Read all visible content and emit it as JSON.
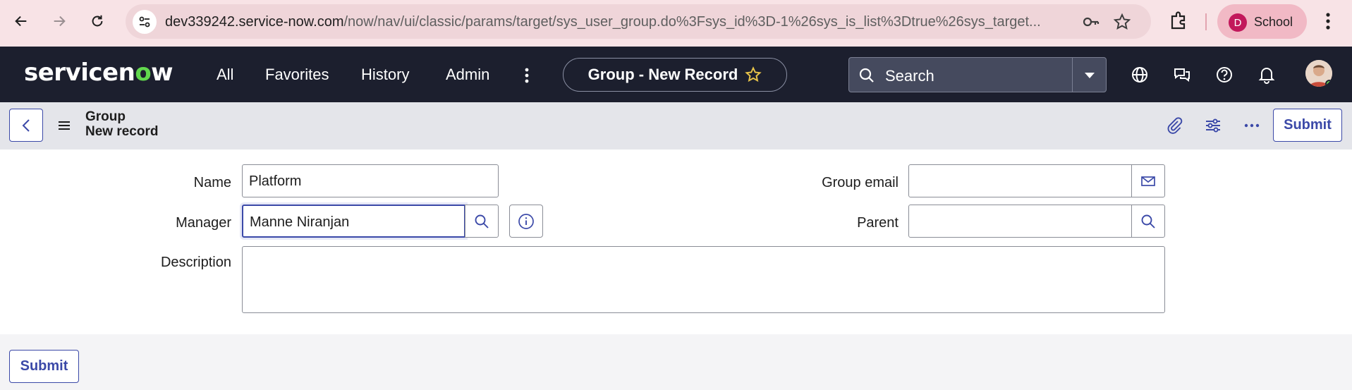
{
  "browser": {
    "url_host": "dev339242.service-now.com",
    "url_path": "/now/nav/ui/classic/params/target/sys_user_group.do%3Fsys_id%3D-1%26sys_is_list%3Dtrue%26sys_target...",
    "profile_initial": "D",
    "profile_name": "School"
  },
  "header": {
    "logo_pre": "servicen",
    "logo_o": "o",
    "logo_post": "w",
    "menu": [
      "All",
      "Favorites",
      "History",
      "Admin"
    ],
    "record_title": "Group - New Record",
    "search_placeholder": "Search"
  },
  "form_header": {
    "table": "Group",
    "subtitle": "New record",
    "submit_label": "Submit"
  },
  "form": {
    "name_label": "Name",
    "name_value": "Platform",
    "manager_label": "Manager",
    "manager_value": "Manne Niranjan",
    "description_label": "Description",
    "description_value": "",
    "group_email_label": "Group email",
    "group_email_value": "",
    "parent_label": "Parent",
    "parent_value": ""
  },
  "footer": {
    "submit_label": "Submit"
  },
  "colors": {
    "header_bg": "#1c1f2e",
    "accent": "#3b49a8",
    "logo_green": "#62d84e",
    "chrome_bg": "#f8e3e6"
  }
}
